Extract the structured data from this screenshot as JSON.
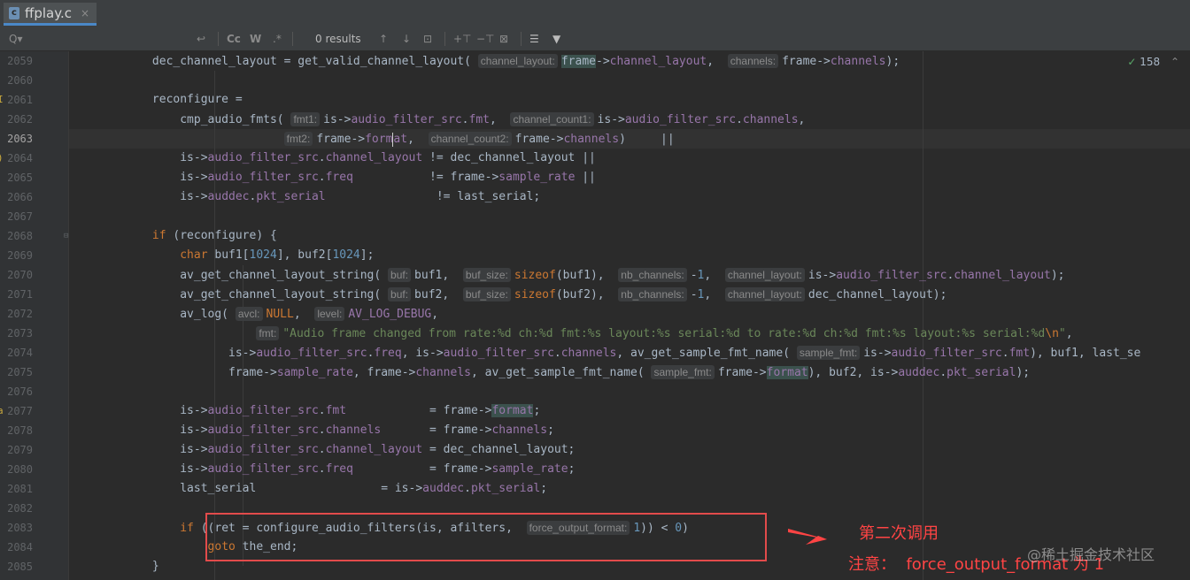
{
  "tab": {
    "label": "ffplay.c",
    "close": "×"
  },
  "findbar": {
    "search_icon": "Q▾",
    "undo_icon": "↩",
    "match_case": "Cc",
    "words": "W",
    "regex": ".*",
    "results": "0 results",
    "prev_icon": "↑",
    "next_icon": "↓",
    "select_all_icon": "⊡",
    "filter_icon": "▼"
  },
  "inspection": {
    "icon": "✓",
    "count": "158",
    "nav": "⌃"
  },
  "lines": [
    {
      "no": "2059",
      "tokens": [
        {
          "t": "            dec_channel_layout = get_valid_channel_layout( "
        },
        {
          "t": "channel_layout:",
          "c": "hint"
        },
        {
          "t": "frame",
          "c": "hl"
        },
        {
          "t": "->"
        },
        {
          "t": "channel_layout",
          "c": "fld"
        },
        {
          "t": ",  "
        },
        {
          "t": "channels:",
          "c": "hint"
        },
        {
          "t": "frame->"
        },
        {
          "t": "channels",
          "c": "fld"
        },
        {
          "t": ");"
        }
      ]
    },
    {
      "no": "2060",
      "tokens": []
    },
    {
      "no": "2061",
      "marker": "I",
      "tokens": [
        {
          "t": "            reconfigure ="
        }
      ]
    },
    {
      "no": "2062",
      "tokens": [
        {
          "t": "                cmp_audio_fmts( "
        },
        {
          "t": "fmt1:",
          "c": "hint"
        },
        {
          "t": "is->"
        },
        {
          "t": "audio_filter_src",
          "c": "fld"
        },
        {
          "t": "."
        },
        {
          "t": "fmt",
          "c": "fld"
        },
        {
          "t": ",  "
        },
        {
          "t": "channel_count1:",
          "c": "hint"
        },
        {
          "t": "is->"
        },
        {
          "t": "audio_filter_src",
          "c": "fld"
        },
        {
          "t": "."
        },
        {
          "t": "channels",
          "c": "fld"
        },
        {
          "t": ","
        }
      ]
    },
    {
      "no": "2063",
      "current": true,
      "tokens": [
        {
          "t": "                               "
        },
        {
          "t": "fmt2:",
          "c": "hint"
        },
        {
          "t": "frame->"
        },
        {
          "t": "form",
          "c": "fld"
        },
        {
          "t": "",
          "c": "caret"
        },
        {
          "t": "at",
          "c": "fld"
        },
        {
          "t": ",  "
        },
        {
          "t": "channel_count2:",
          "c": "hint"
        },
        {
          "t": "frame->"
        },
        {
          "t": "channels",
          "c": "fld"
        },
        {
          "t": ")     ||"
        }
      ]
    },
    {
      "no": "2064",
      "marker": ")",
      "tokens": [
        {
          "t": "                is->"
        },
        {
          "t": "audio_filter_src",
          "c": "fld"
        },
        {
          "t": "."
        },
        {
          "t": "channel_layout",
          "c": "fld"
        },
        {
          "t": " != dec_channel_layout ||"
        }
      ]
    },
    {
      "no": "2065",
      "tokens": [
        {
          "t": "                is->"
        },
        {
          "t": "audio_filter_src",
          "c": "fld"
        },
        {
          "t": "."
        },
        {
          "t": "freq",
          "c": "fld"
        },
        {
          "t": "           != frame->"
        },
        {
          "t": "sample_rate",
          "c": "fld"
        },
        {
          "t": " ||"
        }
      ]
    },
    {
      "no": "2066",
      "tokens": [
        {
          "t": "                is->"
        },
        {
          "t": "auddec",
          "c": "fld"
        },
        {
          "t": "."
        },
        {
          "t": "pkt_serial",
          "c": "fld"
        },
        {
          "t": "                != last_serial;"
        }
      ]
    },
    {
      "no": "2067",
      "tokens": []
    },
    {
      "no": "2068",
      "fold": true,
      "tokens": [
        {
          "t": "            "
        },
        {
          "t": "if",
          "c": "kw"
        },
        {
          "t": " (reconfigure) {"
        }
      ]
    },
    {
      "no": "2069",
      "tokens": [
        {
          "t": "                "
        },
        {
          "t": "char",
          "c": "kw"
        },
        {
          "t": " buf1["
        },
        {
          "t": "1024",
          "c": "num"
        },
        {
          "t": "], buf2["
        },
        {
          "t": "1024",
          "c": "num"
        },
        {
          "t": "];"
        }
      ]
    },
    {
      "no": "2070",
      "tokens": [
        {
          "t": "                av_get_channel_layout_string( "
        },
        {
          "t": "buf:",
          "c": "hint"
        },
        {
          "t": "buf1,  "
        },
        {
          "t": "buf_size:",
          "c": "hint"
        },
        {
          "t": "sizeof",
          "c": "kw"
        },
        {
          "t": "(buf1),  "
        },
        {
          "t": "nb_channels:",
          "c": "hint"
        },
        {
          "t": "-"
        },
        {
          "t": "1",
          "c": "num"
        },
        {
          "t": ",  "
        },
        {
          "t": "channel_layout:",
          "c": "hint"
        },
        {
          "t": "is->"
        },
        {
          "t": "audio_filter_src",
          "c": "fld"
        },
        {
          "t": "."
        },
        {
          "t": "channel_layout",
          "c": "fld"
        },
        {
          "t": ");"
        }
      ]
    },
    {
      "no": "2071",
      "tokens": [
        {
          "t": "                av_get_channel_layout_string( "
        },
        {
          "t": "buf:",
          "c": "hint"
        },
        {
          "t": "buf2,  "
        },
        {
          "t": "buf_size:",
          "c": "hint"
        },
        {
          "t": "sizeof",
          "c": "kw"
        },
        {
          "t": "(buf2),  "
        },
        {
          "t": "nb_channels:",
          "c": "hint"
        },
        {
          "t": "-"
        },
        {
          "t": "1",
          "c": "num"
        },
        {
          "t": ",  "
        },
        {
          "t": "channel_layout:",
          "c": "hint"
        },
        {
          "t": "dec_channel_layout);"
        }
      ]
    },
    {
      "no": "2072",
      "tokens": [
        {
          "t": "                av_log( "
        },
        {
          "t": "avcl:",
          "c": "hint"
        },
        {
          "t": "NULL",
          "c": "kw"
        },
        {
          "t": ",  "
        },
        {
          "t": "level:",
          "c": "hint"
        },
        {
          "t": "AV_LOG_DEBUG",
          "c": "fld"
        },
        {
          "t": ","
        }
      ]
    },
    {
      "no": "2073",
      "tokens": [
        {
          "t": "                           "
        },
        {
          "t": "fmt:",
          "c": "hint"
        },
        {
          "t": "\"Audio frame changed from rate:%d ch:%d fmt:%s layout:%s serial:%d to rate:%d ch:%d fmt:%s layout:%s serial:%d",
          "c": "str"
        },
        {
          "t": "\\n",
          "c": "kw"
        },
        {
          "t": "\"",
          "c": "str"
        },
        {
          "t": ","
        }
      ]
    },
    {
      "no": "2074",
      "tokens": [
        {
          "t": "                       is->"
        },
        {
          "t": "audio_filter_src",
          "c": "fld"
        },
        {
          "t": "."
        },
        {
          "t": "freq",
          "c": "fld"
        },
        {
          "t": ", is->"
        },
        {
          "t": "audio_filter_src",
          "c": "fld"
        },
        {
          "t": "."
        },
        {
          "t": "channels",
          "c": "fld"
        },
        {
          "t": ", av_get_sample_fmt_name( "
        },
        {
          "t": "sample_fmt:",
          "c": "hint"
        },
        {
          "t": "is->"
        },
        {
          "t": "audio_filter_src",
          "c": "fld"
        },
        {
          "t": "."
        },
        {
          "t": "fmt",
          "c": "fld"
        },
        {
          "t": "), buf1, last_se"
        }
      ]
    },
    {
      "no": "2075",
      "tokens": [
        {
          "t": "                       frame->"
        },
        {
          "t": "sample_rate",
          "c": "fld"
        },
        {
          "t": ", frame->"
        },
        {
          "t": "channels",
          "c": "fld"
        },
        {
          "t": ", av_get_sample_fmt_name( "
        },
        {
          "t": "sample_fmt:",
          "c": "hint"
        },
        {
          "t": "frame->"
        },
        {
          "t": "format",
          "c": "fld hl"
        },
        {
          "t": "), buf2, is->"
        },
        {
          "t": "auddec",
          "c": "fld"
        },
        {
          "t": "."
        },
        {
          "t": "pkt_serial",
          "c": "fld"
        },
        {
          "t": ");"
        }
      ]
    },
    {
      "no": "2076",
      "tokens": []
    },
    {
      "no": "2077",
      "marker": "a",
      "tokens": [
        {
          "t": "                is->"
        },
        {
          "t": "audio_filter_src",
          "c": "fld"
        },
        {
          "t": "."
        },
        {
          "t": "fmt",
          "c": "fld"
        },
        {
          "t": "            = frame->"
        },
        {
          "t": "format",
          "c": "fld hl"
        },
        {
          "t": ";"
        }
      ]
    },
    {
      "no": "2078",
      "tokens": [
        {
          "t": "                is->"
        },
        {
          "t": "audio_filter_src",
          "c": "fld"
        },
        {
          "t": "."
        },
        {
          "t": "channels",
          "c": "fld"
        },
        {
          "t": "       = frame->"
        },
        {
          "t": "channels",
          "c": "fld"
        },
        {
          "t": ";"
        }
      ]
    },
    {
      "no": "2079",
      "tokens": [
        {
          "t": "                is->"
        },
        {
          "t": "audio_filter_src",
          "c": "fld"
        },
        {
          "t": "."
        },
        {
          "t": "channel_layout",
          "c": "fld"
        },
        {
          "t": " = dec_channel_layout;"
        }
      ]
    },
    {
      "no": "2080",
      "tokens": [
        {
          "t": "                is->"
        },
        {
          "t": "audio_filter_src",
          "c": "fld"
        },
        {
          "t": "."
        },
        {
          "t": "freq",
          "c": "fld"
        },
        {
          "t": "           = frame->"
        },
        {
          "t": "sample_rate",
          "c": "fld"
        },
        {
          "t": ";"
        }
      ]
    },
    {
      "no": "2081",
      "tokens": [
        {
          "t": "                last_serial                  = is->"
        },
        {
          "t": "auddec",
          "c": "fld"
        },
        {
          "t": "."
        },
        {
          "t": "pkt_serial",
          "c": "fld"
        },
        {
          "t": ";"
        }
      ]
    },
    {
      "no": "2082",
      "tokens": []
    },
    {
      "no": "2083",
      "tokens": [
        {
          "t": "                "
        },
        {
          "t": "if",
          "c": "kw"
        },
        {
          "t": " ((ret = configure_audio_filters(is, afilters,  "
        },
        {
          "t": "force_output_format:",
          "c": "hint"
        },
        {
          "t": "1",
          "c": "num"
        },
        {
          "t": ")) < "
        },
        {
          "t": "0",
          "c": "num"
        },
        {
          "t": ")"
        }
      ]
    },
    {
      "no": "2084",
      "tokens": [
        {
          "t": "                    "
        },
        {
          "t": "goto",
          "c": "kw"
        },
        {
          "t": " the_end;"
        }
      ]
    },
    {
      "no": "2085",
      "tokens": [
        {
          "t": "            }"
        }
      ]
    }
  ],
  "annotation": {
    "line1": "第二次调用",
    "line2": "注意：  force_output_format 为 1",
    "box_color": "#e24b4b",
    "text_color": "#ff4444"
  },
  "watermark": "@稀土掘金技术社区"
}
